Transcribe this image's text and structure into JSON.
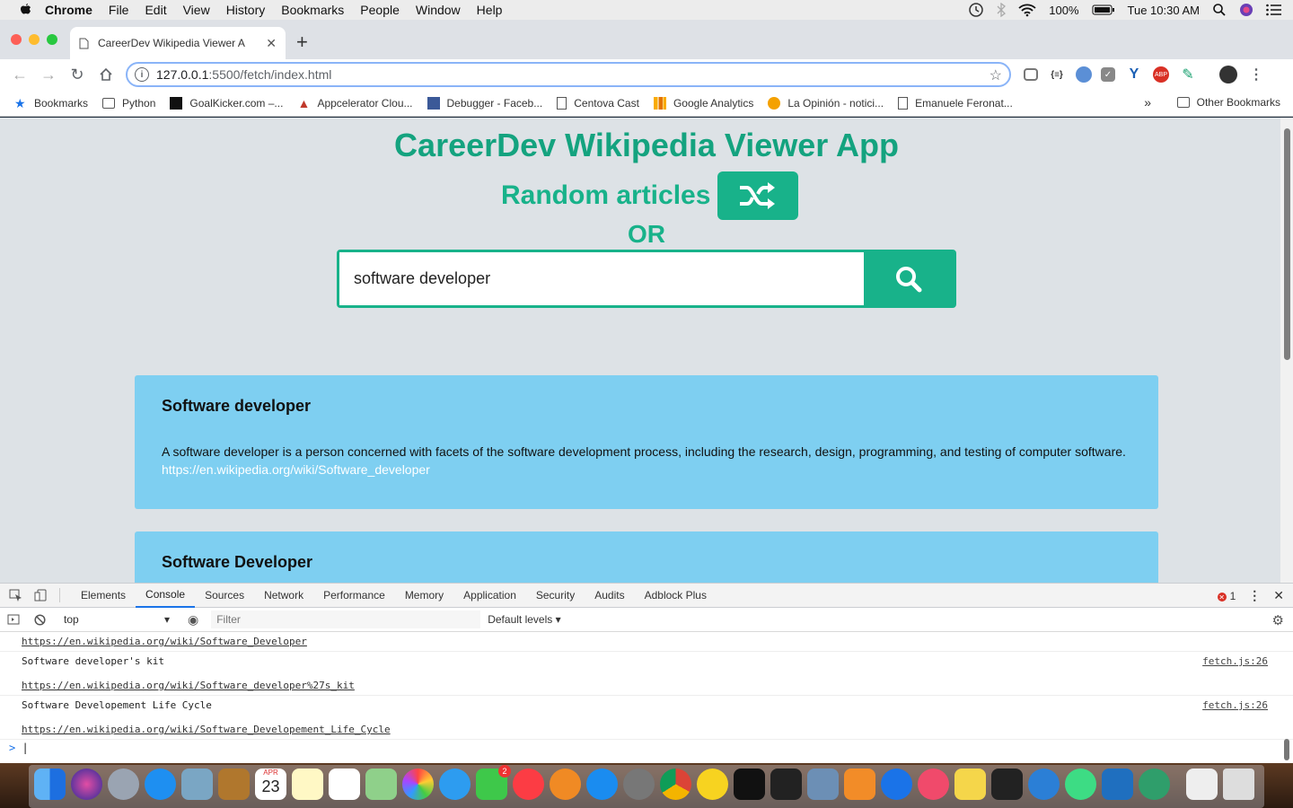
{
  "menubar": {
    "app_name": "Chrome",
    "items": [
      "File",
      "Edit",
      "View",
      "History",
      "Bookmarks",
      "People",
      "Window",
      "Help"
    ],
    "battery": "100%",
    "clock": "Tue 10:30 AM"
  },
  "browser": {
    "tab_title": "CareerDev Wikipedia Viewer A",
    "url_host": "127.0.0.1",
    "url_path": ":5500/fetch/index.html",
    "bookmarks": [
      "Bookmarks",
      "Python",
      "GoalKicker.com –...",
      "Appcelerator Clou...",
      "Debugger - Faceb...",
      "Centova Cast",
      "Google Analytics",
      "La Opinión - notici...",
      "Emanuele Feronat..."
    ],
    "more_bookmarks": "»",
    "other_bookmarks": "Other Bookmarks"
  },
  "page": {
    "title": "CareerDev Wikipedia Viewer App",
    "random_label": "Random articles",
    "or_label": "OR",
    "search_value": "software developer",
    "results": [
      {
        "title": "Software developer",
        "snippet": "A software developer is a person concerned with facets of the software development process, including the research, design, programming, and testing of computer software.",
        "link": "https://en.wikipedia.org/wiki/Software_developer"
      },
      {
        "title": "Software Developer",
        "snippet": "",
        "link": ""
      }
    ]
  },
  "devtools": {
    "tabs": [
      "Elements",
      "Console",
      "Sources",
      "Network",
      "Performance",
      "Memory",
      "Application",
      "Security",
      "Audits",
      "Adblock Plus"
    ],
    "active_tab": "Console",
    "error_count": "1",
    "context": "top",
    "filter_placeholder": "Filter",
    "levels": "Default levels ▾",
    "logs": [
      {
        "text": "",
        "link": "https://en.wikipedia.org/wiki/Software_Developer",
        "source": ""
      },
      {
        "text": "Software developer's kit",
        "link": "https://en.wikipedia.org/wiki/Software_developer%27s_kit",
        "source": "fetch.js:26"
      },
      {
        "text": "Software Developement Life Cycle",
        "link": "https://en.wikipedia.org/wiki/Software_Developement_Life_Cycle",
        "source": "fetch.js:26"
      }
    ],
    "prompt": ">"
  },
  "dock": {
    "calendar_month": "APR",
    "calendar_day": "23",
    "messages_badge": "2"
  },
  "colors": {
    "accent": "#18b28a",
    "title": "#14a37f",
    "card": "#7ecff1",
    "page_bg": "#dde2e6"
  }
}
